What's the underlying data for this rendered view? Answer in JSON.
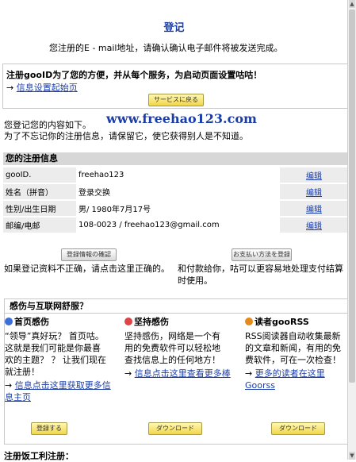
{
  "page": {
    "title": "登记",
    "intro": "您注册的E - mail地址，请确认确认电子邮件将被发送完成。"
  },
  "notice": {
    "heading": "注册gooID为了您的方便，并从每个服务，为启动页面设置咕咕！",
    "arrow": "→",
    "link": "信息设置起始页",
    "button": "サービスに戻る"
  },
  "watermark": "www.freehao123.com",
  "summary": {
    "line1": "您登记您的内容如下。",
    "line2": "为了不忘记你的注册信息，请保留它，使它获得别人是不知道。"
  },
  "registration": {
    "header": "您的注册信息",
    "rows": [
      {
        "label": "gooID.",
        "value": "freehao123",
        "action": "编辑"
      },
      {
        "label": "姓名（拼音）",
        "value": "登录交换",
        "action": "编辑"
      },
      {
        "label": "性别/出生日期",
        "value": "男/ 1980年7月17号",
        "action": "编辑"
      },
      {
        "label": "邮编/电邮",
        "value": "108-0023 / freehao123@gmail.com",
        "action": "编辑"
      }
    ]
  },
  "confirm": {
    "left_button": "登録情報の確認",
    "left_text": "如果登记资料不正确，请点击这里正确的。",
    "right_button": "お支払い方法を登録",
    "right_text": "和付款给你，咕可以更容易地处理支付结算时使用。"
  },
  "section2": {
    "header": "感伤与互联网舒服？",
    "columns": [
      {
        "title": "首页感伤",
        "icon": "home-icon",
        "text": "“领导”真好玩？ 首页咕。 这就是我们可能是你最喜欢的主题？ ？ 让我们现在就注册！",
        "arrow": "→",
        "link": "信息点击这里获取更多信息主页",
        "button": "登録する"
      },
      {
        "title": "坚持感伤",
        "icon": "pin-icon",
        "text": "坚持感伤，网络是一个有用的免费软件可以轻松地查找信息上的任何地方！",
        "arrow": "→",
        "link": "信息点击这里查看更多棒",
        "button": "ダウンロード"
      },
      {
        "title": "读者gooRSS",
        "icon": "rss-icon",
        "text": "RSS阅读器自动收集最新的文章和新闻，有用的免费软件，可在一次检查！",
        "arrow": "→",
        "link": "更多的读者在这里Goorss",
        "button": "ダウンロード"
      }
    ]
  },
  "bottom_text": "注册饭工利注册："
}
